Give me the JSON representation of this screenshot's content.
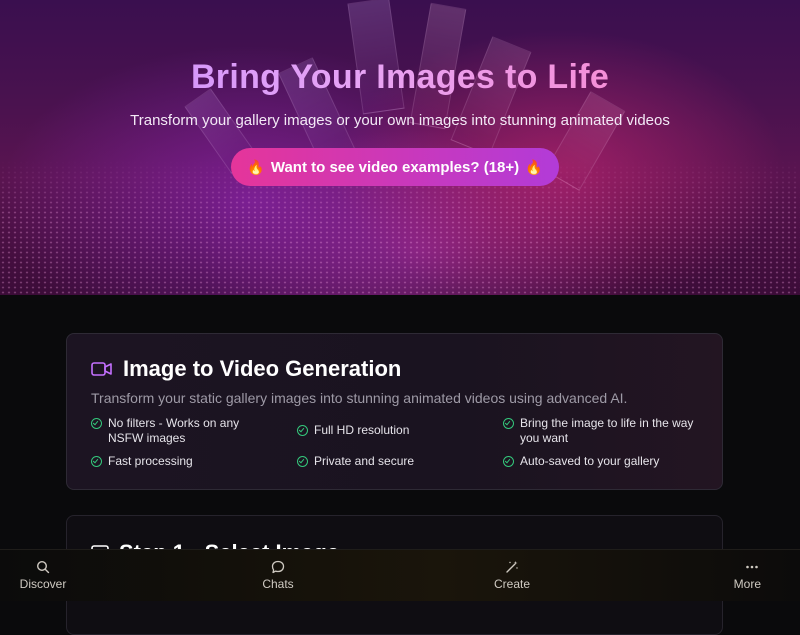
{
  "hero": {
    "title": "Bring Your Images to Life",
    "subtitle": "Transform your gallery images or your own images into stunning animated videos",
    "examples_button": "Want to see video examples? (18+)"
  },
  "feature_card": {
    "title": "Image to Video Generation",
    "description": "Transform your static gallery images into stunning animated videos using advanced AI.",
    "features": [
      "No filters - Works on any NSFW images",
      "Full HD resolution",
      "Bring the image to life in the way you want",
      "Fast processing",
      "Private and secure",
      "Auto-saved to your gallery"
    ]
  },
  "step_card": {
    "title": "Step 1 - Select Image"
  },
  "bottom_nav": {
    "items": [
      {
        "label": "Discover",
        "icon": "search-icon"
      },
      {
        "label": "Chats",
        "icon": "chat-icon"
      },
      {
        "label": "Create",
        "icon": "magic-wand-icon"
      },
      {
        "label": "More",
        "icon": "more-dots-icon"
      }
    ]
  },
  "colors": {
    "accent_pink": "#e5359a",
    "accent_purple": "#b23bd8",
    "check_green": "#34c77b",
    "video_icon": "#c470ff"
  }
}
